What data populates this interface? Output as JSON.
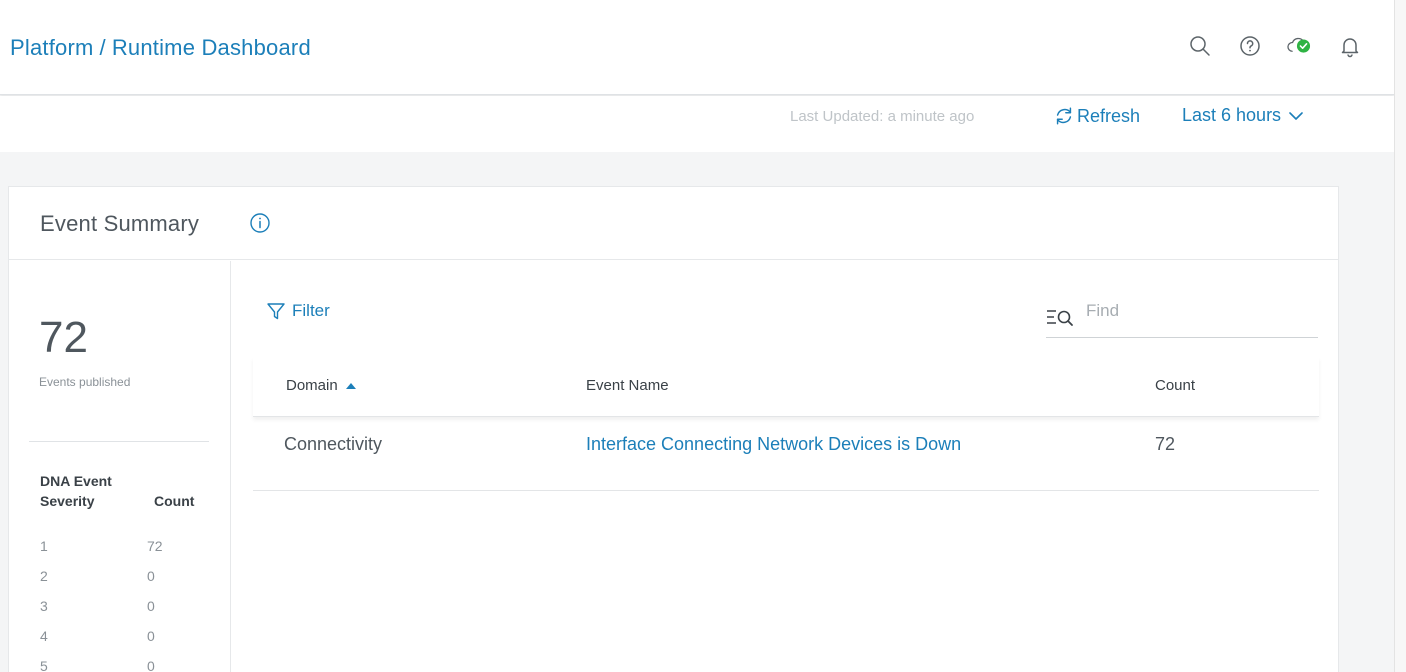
{
  "header": {
    "breadcrumb": {
      "parent": "Platform",
      "separator": "/",
      "current": "Runtime Dashboard"
    },
    "icons": [
      "search-icon",
      "help-icon",
      "cloud-status-icon",
      "notification-bell-icon"
    ],
    "colors": {
      "accent": "#1c7fb9",
      "status_ok": "#2fb344"
    }
  },
  "toolbar": {
    "last_updated": "Last Updated: a minute ago",
    "refresh_label": "Refresh",
    "time_range": "Last 6 hours"
  },
  "card": {
    "title": "Event Summary",
    "stats": {
      "total": "72",
      "total_label": "Events published",
      "severity_header": {
        "title": "DNA Event",
        "col1": "Severity",
        "col2": "Count"
      },
      "severity_rows": [
        {
          "severity": "1",
          "count": "72"
        },
        {
          "severity": "2",
          "count": "0"
        },
        {
          "severity": "3",
          "count": "0"
        },
        {
          "severity": "4",
          "count": "0"
        },
        {
          "severity": "5",
          "count": "0"
        }
      ]
    },
    "filter_label": "Filter",
    "find": {
      "placeholder": "Find",
      "value": ""
    },
    "table": {
      "columns": {
        "domain": "Domain",
        "event_name": "Event Name",
        "count": "Count"
      },
      "rows": [
        {
          "domain": "Connectivity",
          "event_name": "Interface Connecting Network Devices is Down",
          "count": "72"
        }
      ]
    }
  }
}
